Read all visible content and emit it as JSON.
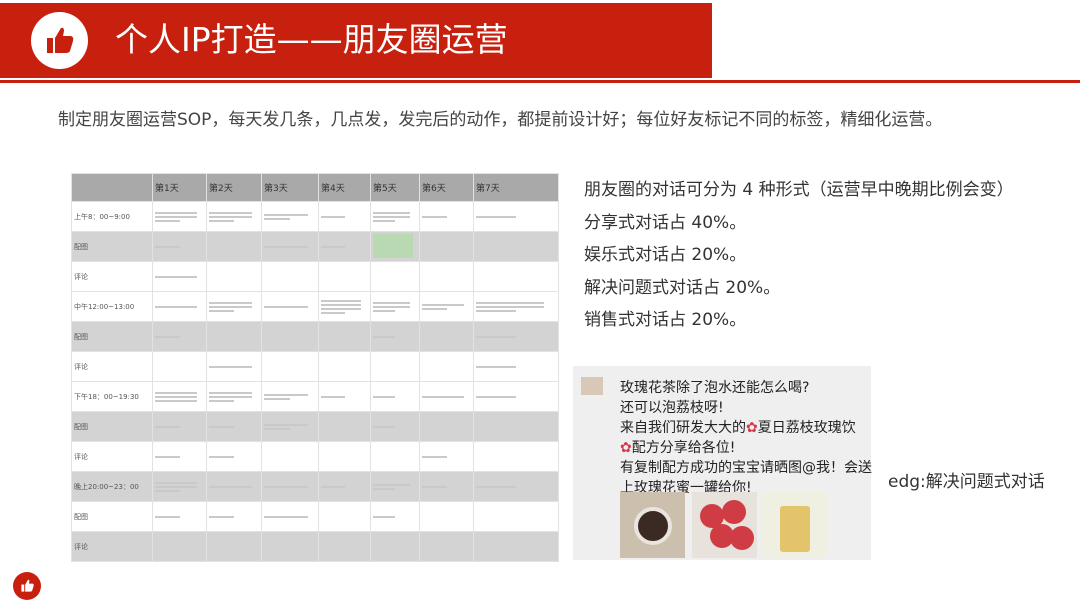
{
  "header": {
    "title": "个人IP打造——朋友圈运营"
  },
  "intro": {
    "text": "制定朋友圈运营SOP，每天发几条，几点发，发完后的动作，都提前设计好；每位好友标记不同的标签，精细化运营。"
  },
  "sop_table": {
    "columns": [
      "",
      "第1天",
      "第2天",
      "第3天",
      "第4天",
      "第5天",
      "第6天",
      "第7天"
    ],
    "row_labels": [
      "上午8：00~9:00",
      "配图",
      "评论",
      "中午12:00~13:00",
      "配图",
      "评论",
      "下午18：00~19:30",
      "配图",
      "评论",
      "晚上20:00~23：00",
      "配图",
      "评论"
    ]
  },
  "forms": {
    "heading": "朋友圈的对话可分为 4 种形式（运营早中晚期比例会变）",
    "items": [
      "分享式对话占 40%。",
      "娱乐式对话占 20%。",
      "解决问题式对话占 20%。",
      "销售式对话占 20%。"
    ]
  },
  "post": {
    "lines": [
      "玫瑰花茶除了泡水还能怎么喝?",
      "还可以泡荔枝呀!",
      "来自我们研发大大的",
      "夏日荔枝玫瑰饮",
      "配方分享给各位!",
      "有复制配方成功的宝宝请晒图@我！会送",
      "上玫瑰花蜜一罐给你!"
    ]
  },
  "example_label": "edg:解决问题式对话",
  "icons": {
    "title": "thumbs-up-icon",
    "badge": "thumbs-up-icon"
  },
  "colors": {
    "accent": "#c8200e"
  }
}
